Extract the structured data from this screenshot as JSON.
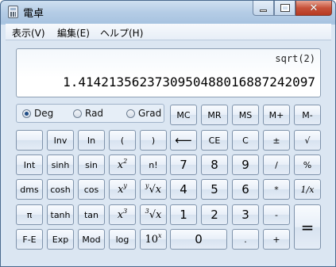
{
  "window": {
    "title": "電卓"
  },
  "menu": [
    "表示(V)",
    "編集(E)",
    "ヘルプ(H)"
  ],
  "display": {
    "expression": "sqrt(2)",
    "result": "1.4142135623730950488016887242097"
  },
  "angle_modes": [
    {
      "label": "Deg",
      "selected": true
    },
    {
      "label": "Rad",
      "selected": false
    },
    {
      "label": "Grad",
      "selected": false
    }
  ],
  "memory": [
    "MC",
    "MR",
    "MS",
    "M+",
    "M-"
  ],
  "keys": {
    "inv": "Inv",
    "ln": "In",
    "lparen": "(",
    "rparen": ")",
    "int": "Int",
    "sinh": "sinh",
    "sin": "sin",
    "fact": "n!",
    "dms": "dms",
    "cosh": "cosh",
    "cos": "cos",
    "pi": "π",
    "tanh": "tanh",
    "tan": "tan",
    "fe": "F-E",
    "exp": "Exp",
    "mod": "Mod",
    "log": "log",
    "backspace": "⟵",
    "ce": "CE",
    "c": "C",
    "plusminus": "±",
    "sqrt": "√",
    "d7": "7",
    "d8": "8",
    "d9": "9",
    "div": "/",
    "pct": "%",
    "d4": "4",
    "d5": "5",
    "d6": "6",
    "mul": "*",
    "recip": "1/x",
    "d1": "1",
    "d2": "2",
    "d3": "3",
    "sub": "-",
    "eq": "=",
    "d0": "0",
    "dot": ".",
    "add": "+",
    "x_base": "x",
    "sq_exp": "2",
    "pow_exp": "y",
    "cube_exp": "3",
    "yroot_idx": "y",
    "root3_idx": "3",
    "ten_base": "10",
    "ten_exp": "x"
  }
}
